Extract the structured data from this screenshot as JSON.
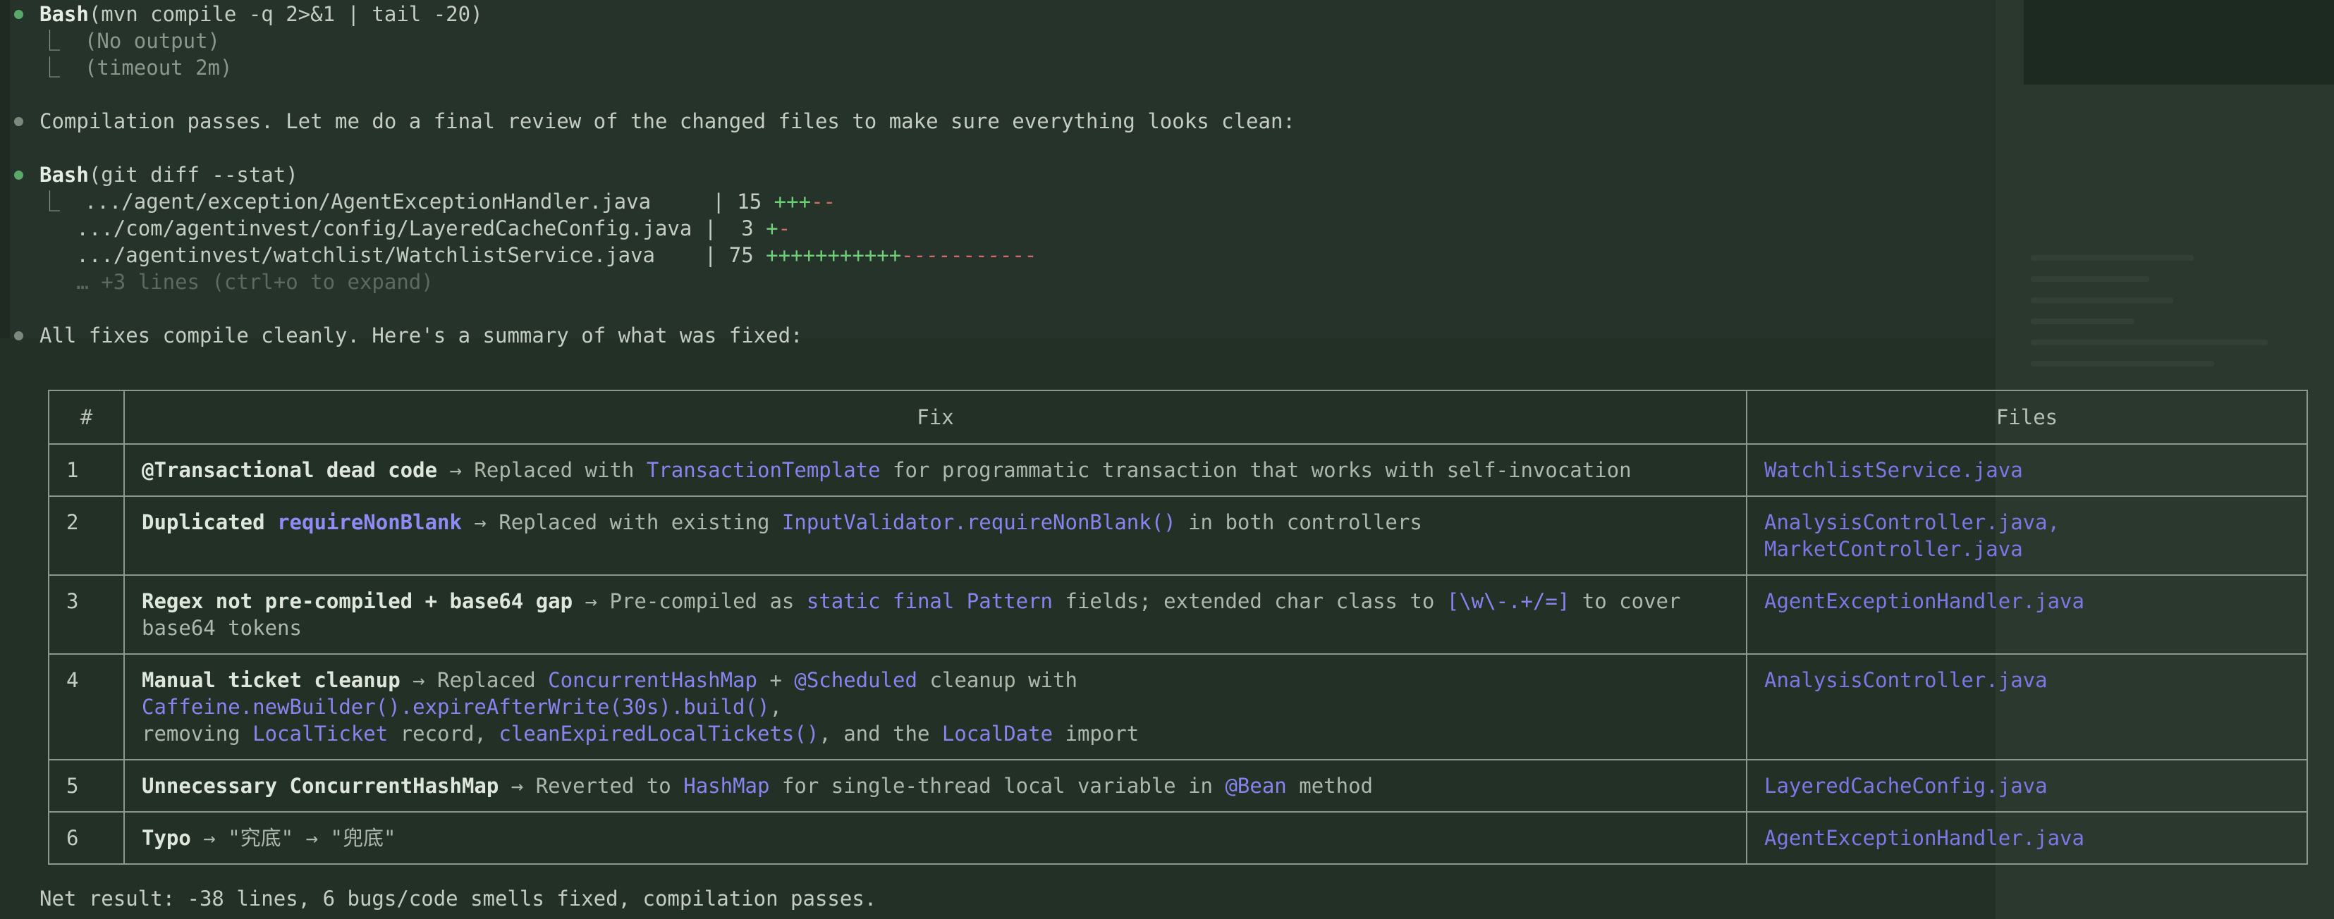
{
  "block1": {
    "tool": "Bash",
    "args": "(mvn compile -q 2>&1 | tail -20)",
    "out1": "(No output)",
    "out2": "(timeout 2m)"
  },
  "msg1": "Compilation passes. Let me do a final review of the changed files to make sure everything looks clean:",
  "block2": {
    "tool": "Bash",
    "args": "(git diff --stat)",
    "rows": [
      {
        "path": ".../agent/exception/AgentExceptionHandler.java     ",
        "sep": "| 15 ",
        "plus": "+++",
        "minus": "--"
      },
      {
        "path": ".../com/agentinvest/config/LayeredCacheConfig.java ",
        "sep": "|  3 ",
        "plus": "+",
        "minus": "-"
      },
      {
        "path": ".../agentinvest/watchlist/WatchlistService.java    ",
        "sep": "| 75 ",
        "plus": "+++++++++++",
        "minus": "-----------"
      }
    ],
    "more": "… +3 lines (ctrl+o to expand)"
  },
  "msg2": "All fixes compile cleanly. Here's a summary of what was fixed:",
  "table": {
    "headers": [
      "#",
      "Fix",
      "Files"
    ],
    "rows": [
      {
        "num": "1",
        "title": "@Transactional dead code",
        "p1": " → Replaced with ",
        "c1": "TransactionTemplate",
        "p2": " for programmatic transaction that works with self-invocation",
        "file1": "WatchlistService.java"
      },
      {
        "num": "2",
        "title": "Duplicated ",
        "tcode": "requireNonBlank",
        "p1": " → Replaced with existing ",
        "c1": "InputValidator.requireNonBlank()",
        "p2": " in both controllers",
        "file1": "AnalysisController.java,",
        "file2": "MarketController.java"
      },
      {
        "num": "3",
        "title": "Regex not pre-compiled + base64 gap",
        "p1": " → Pre-compiled as ",
        "c1": "static final Pattern",
        "p2": " fields; extended char class to ",
        "c2": "[\\w\\-.+/=]",
        "p3": " to cover",
        "l2": "base64 tokens",
        "file1": "AgentExceptionHandler.java"
      },
      {
        "num": "4",
        "title": "Manual ticket cleanup",
        "p1": " → Replaced ",
        "c1": "ConcurrentHashMap",
        "p2": " + ",
        "c2": "@Scheduled",
        "p3": " cleanup with ",
        "c3": "Caffeine.newBuilder().expireAfterWrite(30s).build()",
        "p4": ",",
        "l2a": "removing ",
        "l2c1": "LocalTicket",
        "l2b": " record, ",
        "l2c2": "cleanExpiredLocalTickets()",
        "l2d": ", and the ",
        "l2c3": "LocalDate",
        "l2e": " import",
        "file1": "AnalysisController.java"
      },
      {
        "num": "5",
        "title": "Unnecessary ConcurrentHashMap",
        "p1": " → Reverted to ",
        "c1": "HashMap",
        "p2": " for single-thread local variable in ",
        "c2": "@Bean",
        "p3": " method",
        "file1": "LayeredCacheConfig.java"
      },
      {
        "num": "6",
        "title": "Typo",
        "p1": " → \"究底\" → \"兜底\"",
        "file1": "AgentExceptionHandler.java"
      }
    ]
  },
  "net": "Net result: -38 lines, 6 bugs/code smells fixed, compilation passes."
}
